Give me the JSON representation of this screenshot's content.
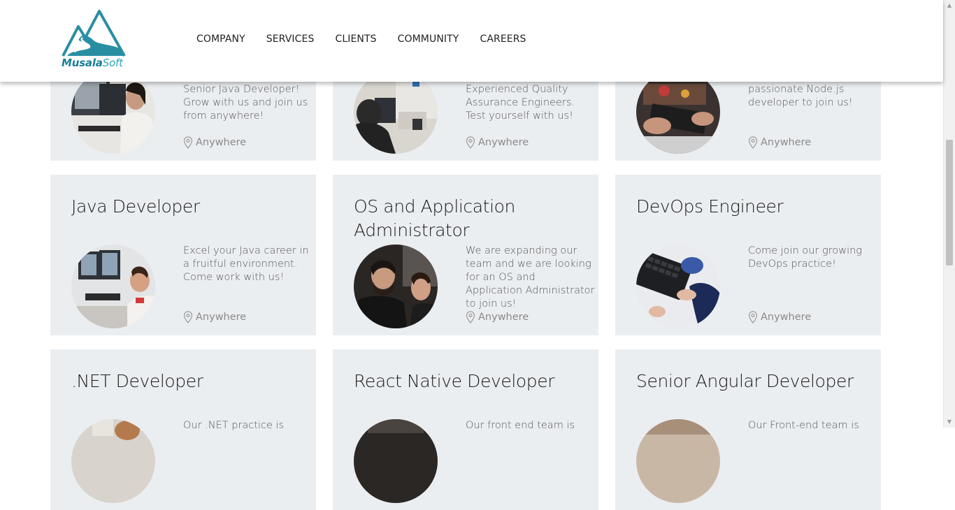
{
  "header": {
    "logo_primary": "Musala",
    "logo_secondary": "Soft",
    "nav": [
      "COMPANY",
      "SERVICES",
      "CLIENTS",
      "COMMUNITY",
      "CAREERS"
    ]
  },
  "colors": {
    "card_bg": "#ebeef1",
    "brand": "#2a8ea3",
    "text": "#1a1a1a",
    "muted": "#8a8a8a"
  },
  "jobs": [
    {
      "title": "",
      "description": "Senior Java Developer! Grow with us and join us from anywhere!",
      "location": "Anywhere"
    },
    {
      "title": "",
      "description": "Experienced Quality Assurance Engineers. Test yourself with us!",
      "location": "Anywhere"
    },
    {
      "title": "",
      "description": "passionate Node.js developer to join us!",
      "location": "Anywhere"
    },
    {
      "title": "Java Developer",
      "description": "Excel your Java career in a fruitful environment. Come work with us!",
      "location": "Anywhere"
    },
    {
      "title": "OS and Application Administrator",
      "description": "We are expanding our team and we are looking for an OS and Application Administrator to join us!",
      "location": "Anywhere"
    },
    {
      "title": "DevOps Engineer",
      "description": "Come join our growing DevOps practice!",
      "location": "Anywhere"
    },
    {
      "title": ".NET Developer",
      "description": "Our .NET practice is",
      "location": ""
    },
    {
      "title": "React Native Developer",
      "description": "Our front end team is",
      "location": ""
    },
    {
      "title": "Senior Angular Developer",
      "description": "Our Front-end team is",
      "location": ""
    }
  ]
}
